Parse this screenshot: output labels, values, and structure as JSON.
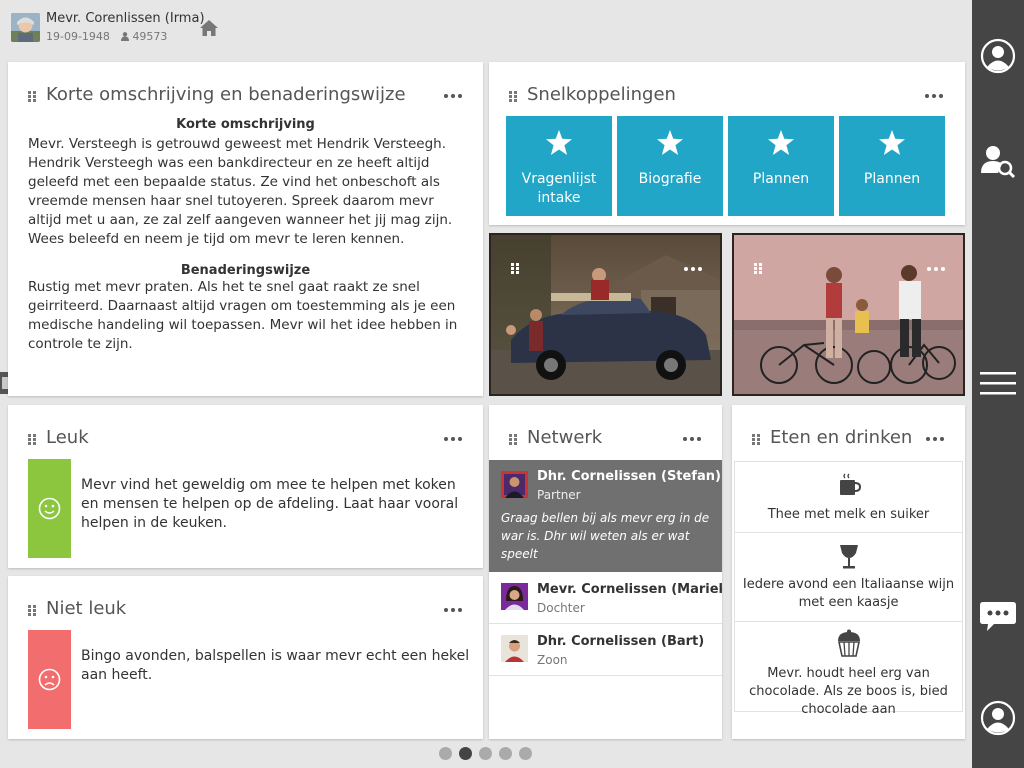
{
  "header": {
    "client_name": "Mevr. Corenlissen (Irma)",
    "birth_date": "19-09-1948",
    "client_number": "49573"
  },
  "description_card": {
    "title": "Korte omschrijving en benaderingswijze",
    "subtitle_1": "Korte omschrijving",
    "text_1": "Mevr. Versteegh is getrouwd geweest met Hendrik Versteegh. Hendrik Versteegh was een bankdirecteur en ze heeft altijd geleefd met een bepaalde status. Ze vind het onbeschoft als vreemde mensen haar snel tutoyeren. Spreek daarom mevr altijd met u aan, ze zal zelf aangeven wanneer het jij mag zijn. Wees beleefd en neem je tijd om mevr te leren kennen.",
    "subtitle_2": "Benaderingswijze",
    "text_2": "Rustig met mevr praten. Als het te snel gaat raakt ze snel geirriteerd. Daarnaast altijd vragen om toestemming als je een medische handeling wil toepassen. Mevr wil het idee hebben in controle te zijn."
  },
  "shortcuts_card": {
    "title": "Snelkoppelingen",
    "tiles": [
      {
        "label": "Vragenlijst intake",
        "icon": "star-icon"
      },
      {
        "label": "Biografie",
        "icon": "star-icon"
      },
      {
        "label": "Plannen",
        "icon": "star-icon"
      },
      {
        "label": "Plannen",
        "icon": "star-icon"
      }
    ],
    "tile_color": "#22a6c8"
  },
  "likes_card": {
    "title": "Leuk",
    "text": "Mevr vind het geweldig om mee te helpen met koken en mensen te helpen op de afdeling. Laat haar vooral helpen in de keuken.",
    "color": "#8cc63f",
    "icon": "smile-icon"
  },
  "dislikes_card": {
    "title": "Niet leuk",
    "text": "Bingo avonden, balspellen is waar mevr echt een hekel aan heeft.",
    "color": "#f26d6d",
    "icon": "frown-icon"
  },
  "network_card": {
    "title": "Netwerk",
    "contacts": [
      {
        "name": "Dhr. Cornelissen (Stefan)",
        "role": "Partner",
        "note": "Graag bellen bij als mevr erg in de war is. Dhr wil weten als er wat speelt"
      },
      {
        "name": "Mevr. Cornelissen (Marieke)",
        "role": "Dochter"
      },
      {
        "name": "Dhr. Cornelissen (Bart)",
        "role": "Zoon"
      }
    ],
    "selected_color": "#707070"
  },
  "food_card": {
    "title": "Eten en drinken",
    "items": [
      {
        "text": "Thee met melk en suiker",
        "icon": "coffee-cup-icon"
      },
      {
        "text": "Iedere avond een Italiaanse wijn met een kaasje",
        "icon": "wine-glass-icon"
      },
      {
        "text": "Mevr. houdt heel erg van chocolade. Als ze boos is, bied chocolade aan",
        "icon": "cupcake-icon"
      }
    ]
  },
  "pagination": {
    "pages": 5,
    "active": 2
  },
  "sidebar": {
    "items": [
      "profile-icon",
      "search-person-icon",
      "menu-icon",
      "chat-icon",
      "account-icon"
    ],
    "color": "#454545"
  }
}
